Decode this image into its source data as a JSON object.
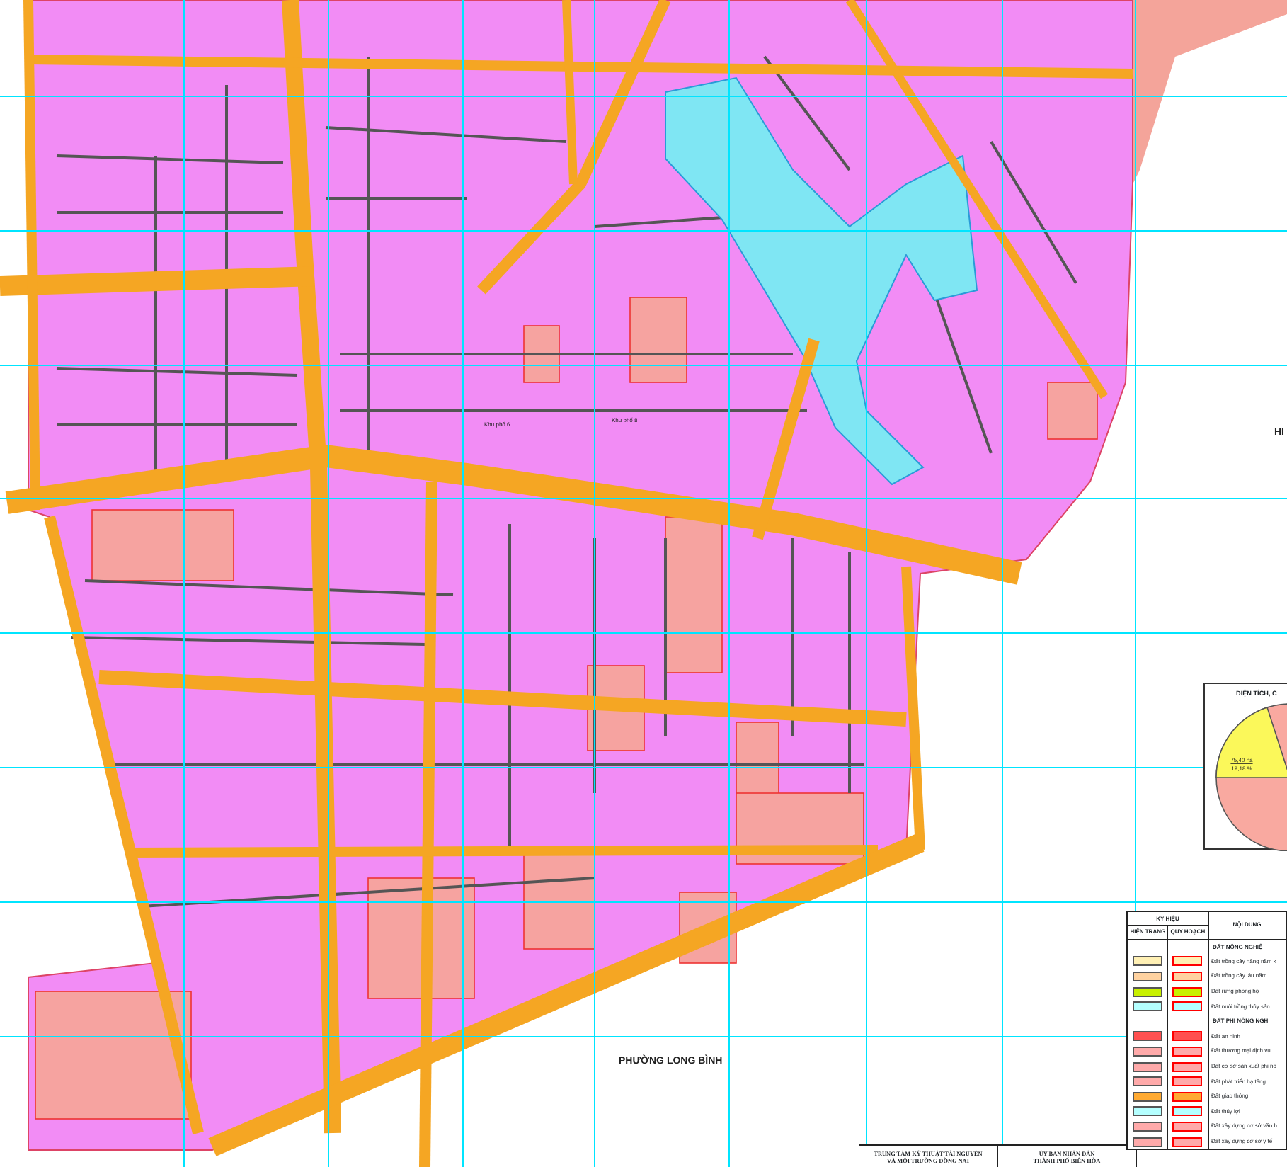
{
  "map": {
    "area_labels": [
      {
        "text": "Khu phố 6"
      },
      {
        "text": "Khu phố 8"
      }
    ],
    "ward_label": "PHƯỜNG LONG BÌNH",
    "edge_label": "HI"
  },
  "pie_chart": {
    "title": "DIỆN TÍCH, C",
    "slice_label": "75,40 ha",
    "slice_percent": "19,18 %"
  },
  "legend": {
    "title": "KÝ HIỆU",
    "columns": [
      "HIỆN TRẠNG",
      "QUY HOẠCH",
      "NỘI DUNG"
    ],
    "groups": [
      {
        "heading": "ĐẤT NÔNG NGHIỆ",
        "items": [
          {
            "label": "Đất trồng cây hàng năm k",
            "color": "#fff0b4"
          },
          {
            "label": "Đất trồng cây lâu năm",
            "color": "#ffd2a0"
          },
          {
            "label": "Đất rừng phòng hộ",
            "color": "#c8f000"
          },
          {
            "label": "Đất nuôi trồng thủy sản",
            "color": "#b4ffff"
          }
        ]
      },
      {
        "heading": "ĐẤT PHI NÔNG NGH",
        "items": [
          {
            "label": "Đất an ninh",
            "color": "#ff5050"
          },
          {
            "label": "Đất thương mại dịch vụ",
            "color": "#ffaaaa"
          },
          {
            "label": "Đất cơ sở sản xuất phi nô",
            "color": "#ffaaaa"
          },
          {
            "label": "Đất phát triển hạ tầng",
            "color": "#ffaaaa"
          },
          {
            "label": "Đất giao thông",
            "color": "#ffaa32"
          },
          {
            "label": "Đất thủy lợi",
            "color": "#b4ffff"
          },
          {
            "label": "Đất xây dựng cơ sở văn h",
            "color": "#ffaaaa"
          },
          {
            "label": "Đất xây dựng cơ sở y tế",
            "color": "#ffaaaa"
          }
        ]
      }
    ]
  },
  "title_block": [
    {
      "lines": [
        "TRUNG TÂM KỸ THUẬT TÀI NGUYÊN",
        "VÀ MÔI TRƯỜNG ĐỒNG NAI"
      ]
    },
    {
      "lines": [
        "ỦY BAN NHÂN DÂN",
        "THÀNH PHỐ BIÊN HÒA"
      ]
    }
  ]
}
